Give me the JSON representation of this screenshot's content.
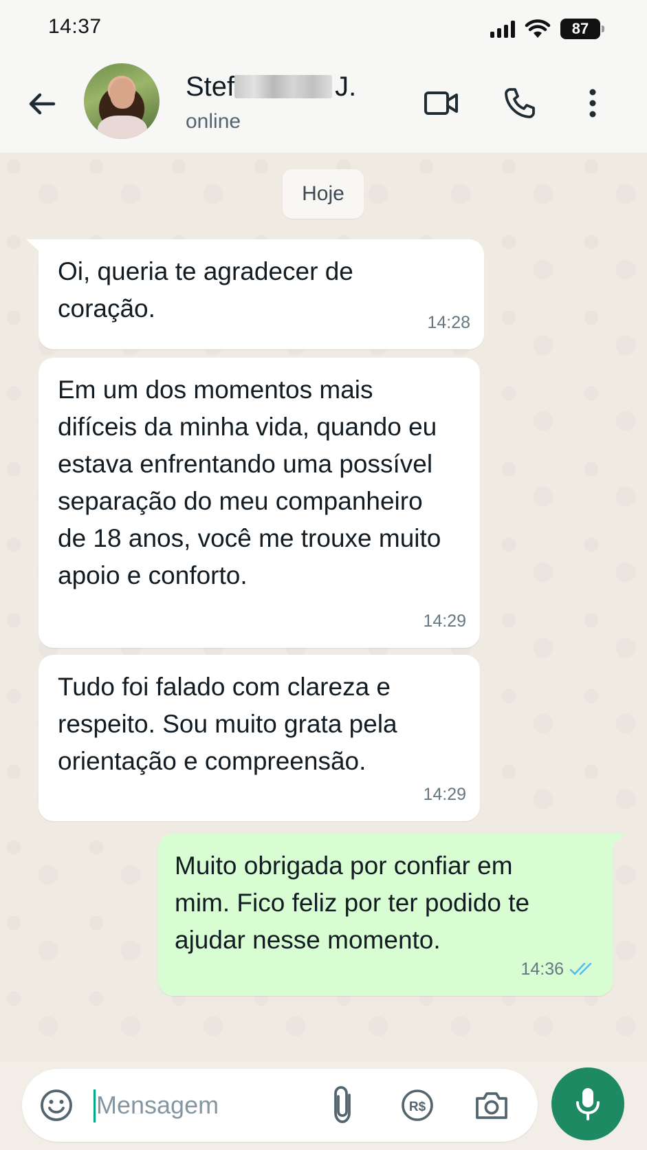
{
  "status_bar": {
    "time": "14:37",
    "battery": "87",
    "icons": [
      "signal-icon",
      "wifi-icon",
      "battery-icon"
    ]
  },
  "header": {
    "contact_name_prefix": "Stef",
    "contact_name_suffix": "J.",
    "status": "online",
    "icons": [
      "back-arrow-icon",
      "avatar",
      "video-call-icon",
      "phone-icon",
      "more-vertical-icon"
    ]
  },
  "chat": {
    "date_chip": "Hoje",
    "messages": [
      {
        "direction": "incoming",
        "text": "Oi, queria te agradecer de coração.",
        "time": "14:28"
      },
      {
        "direction": "incoming",
        "text": "Em um dos momentos mais difíceis da minha vida, quando eu estava enfrentando uma possível separação do meu companheiro de 18 anos, você me trouxe muito apoio e conforto.",
        "time": "14:29"
      },
      {
        "direction": "incoming",
        "text": "Tudo foi falado com clareza e respeito. Sou muito grata pela orientação e compreensão.",
        "time": "14:29"
      },
      {
        "direction": "outgoing",
        "text": "Muito obrigada por confiar em mim. Fico feliz por ter podido te ajudar nesse momento.",
        "time": "14:36",
        "read_receipt": "double-check-blue"
      }
    ]
  },
  "input_bar": {
    "placeholder": "Mensagem",
    "value": "",
    "icons": [
      "emoji-icon",
      "attach-clip-icon",
      "pix-payment-icon",
      "camera-icon",
      "microphone-icon"
    ]
  },
  "colors": {
    "accent_green": "#1d8a63",
    "outgoing_bubble": "#d9fdd3",
    "incoming_bubble": "#ffffff",
    "read_tick": "#53bdeb",
    "chat_background": "#efeae2"
  }
}
